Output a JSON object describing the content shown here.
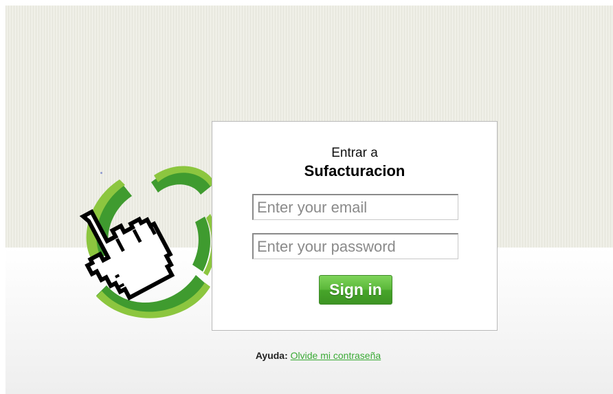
{
  "login": {
    "title": "Entrar a",
    "brand": "Sufacturacion",
    "email_placeholder": "Enter your email",
    "password_placeholder": "Enter your password",
    "signin_label": "Sign in"
  },
  "help": {
    "label": "Ayuda:",
    "link_text": "Olvide mi contraseña"
  },
  "colors": {
    "accent_green": "#3aaa35",
    "button_green": "#4caf2e"
  },
  "icons": [
    "hand-cursor-icon",
    "green-arc-icon"
  ]
}
